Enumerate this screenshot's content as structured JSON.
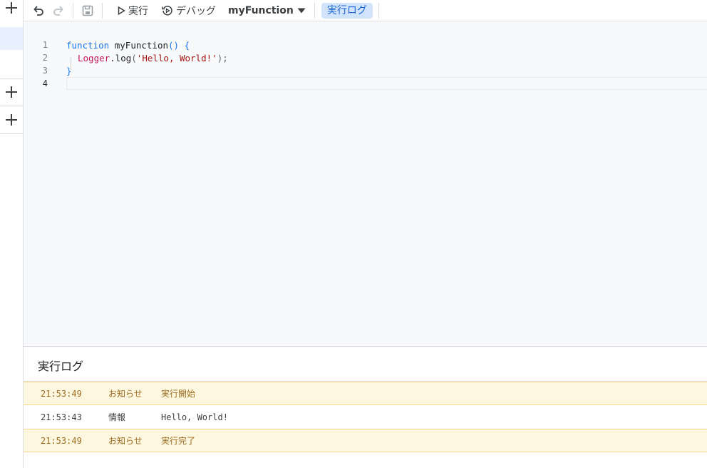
{
  "toolbar": {
    "run_label": "実行",
    "debug_label": "デバッグ",
    "function_name": "myFunction",
    "log_label": "実行ログ"
  },
  "editor": {
    "lines": [
      {
        "number": "1"
      },
      {
        "number": "2"
      },
      {
        "number": "3"
      },
      {
        "number": "4"
      }
    ],
    "code": {
      "l1_keyword": "function",
      "l1_name": " myFunction",
      "l1_paren": "()",
      "l1_brace": " {",
      "l2_obj": "Logger",
      "l2_method": ".log",
      "l2_open": "(",
      "l2_string": "'Hello, World!'",
      "l2_close": ");",
      "l3_brace": "}"
    }
  },
  "log_panel": {
    "title": "実行ログ",
    "rows": [
      {
        "type": "notice",
        "time": "21:53:49",
        "level": "お知らせ",
        "message": "実行開始"
      },
      {
        "type": "info",
        "time": "21:53:43",
        "level": "情報",
        "message": "Hello, World!"
      },
      {
        "type": "notice",
        "time": "21:53:49",
        "level": "お知らせ",
        "message": "実行完了"
      }
    ]
  },
  "colors": {
    "accent": "#1a73e8",
    "log_highlight": "#d2e3fc",
    "notice_bg": "#fef7e0",
    "selected_rail": "#e8f0fe"
  }
}
